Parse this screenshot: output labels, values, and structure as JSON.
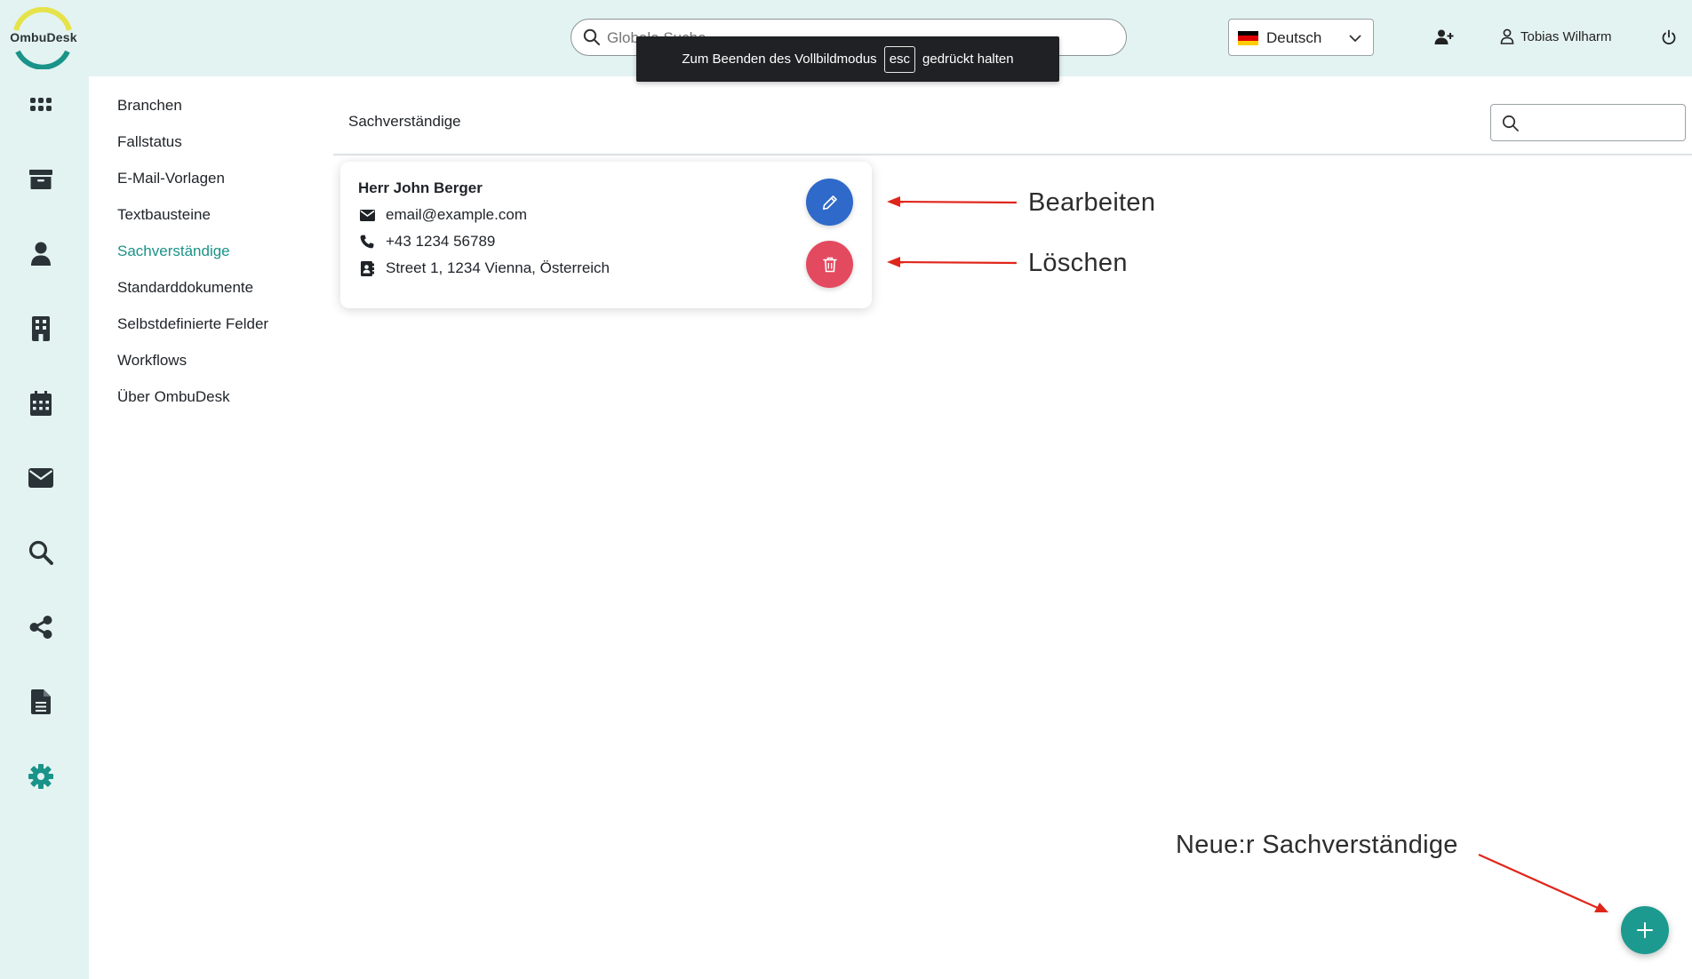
{
  "app": {
    "logo_text": "OmbuDesk",
    "brand_color": "#1a9389"
  },
  "header": {
    "global_search_placeholder": "Globale Suche",
    "fullscreen_toast": {
      "before": "Zum Beenden des Vollbildmodus",
      "key": "esc",
      "after": "gedrückt halten"
    },
    "language": {
      "label": "Deutsch",
      "flag": "flag-de-icon"
    },
    "user_name": "Tobias Wilharm",
    "icons": [
      "add-user-icon",
      "user-icon",
      "power-icon"
    ]
  },
  "rail": {
    "icons": [
      "grid-icon",
      "archive-icon",
      "person-icon",
      "building-icon",
      "calendar-icon",
      "mail-icon",
      "search-icon",
      "share-icon",
      "document-icon",
      "gear-icon"
    ],
    "active": "gear-icon"
  },
  "settings_menu": {
    "items": [
      {
        "label": "Branchen"
      },
      {
        "label": "Fallstatus"
      },
      {
        "label": "E-Mail-Vorlagen"
      },
      {
        "label": "Textbausteine"
      },
      {
        "label": "Sachverständige",
        "active": true
      },
      {
        "label": "Standarddokumente"
      },
      {
        "label": "Selbstdefinierte Felder"
      },
      {
        "label": "Workflows"
      },
      {
        "label": "Über OmbuDesk"
      }
    ]
  },
  "main": {
    "title": "Sachverständige",
    "search_placeholder": "",
    "experts": [
      {
        "name": "Herr John Berger",
        "email": "email@example.com",
        "phone": "+43 1234 56789",
        "address": "Street 1, 1234 Vienna, Österreich"
      }
    ]
  },
  "annotations": {
    "edit": "Bearbeiten",
    "delete": "Löschen",
    "new": "Neue:r Sachverständige"
  },
  "colors": {
    "edit_button": "#2f69c9",
    "delete_button": "#e34a5f",
    "fab": "#1d9a8f",
    "annotation_arrow": "#e0261b"
  }
}
